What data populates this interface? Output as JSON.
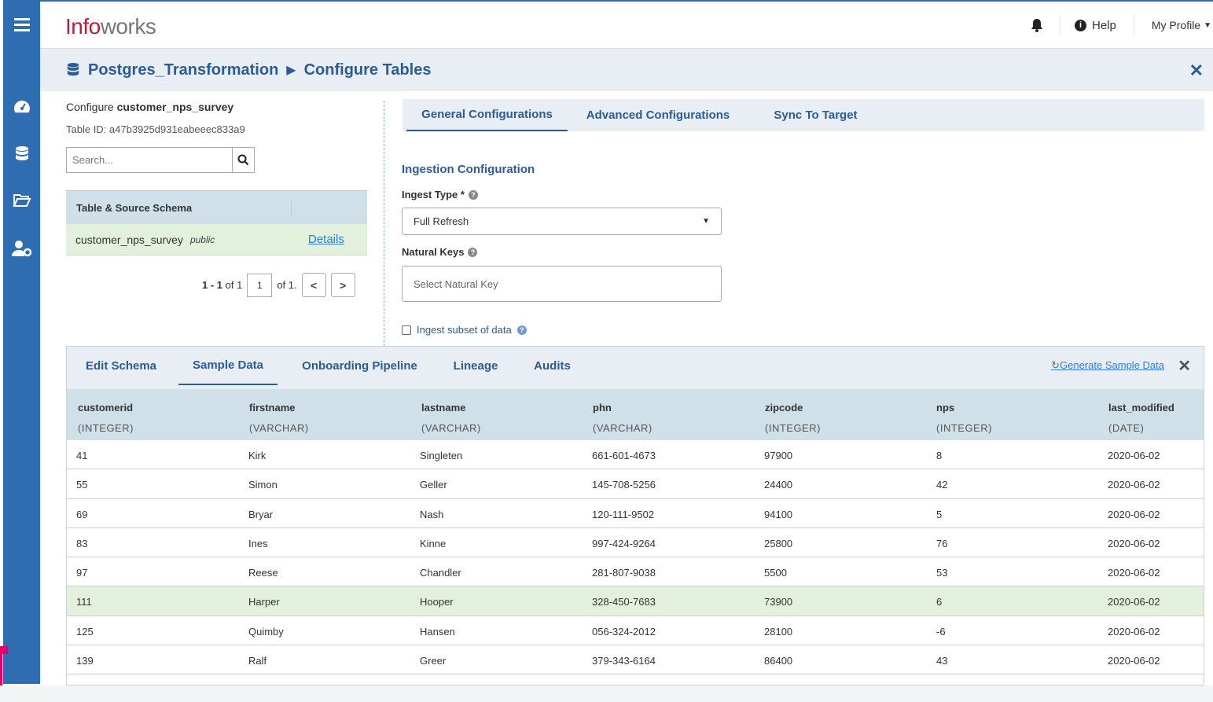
{
  "app": {
    "logo_a": "Info",
    "logo_b": "works"
  },
  "topbar": {
    "help": "Help",
    "profile": "My Profile"
  },
  "breadcrumb": {
    "source": "Postgres_Transformation",
    "page": "Configure Tables"
  },
  "left": {
    "configure_prefix": "Configure",
    "table_name": "customer_nps_survey",
    "table_id": "Table ID: a47b3925d931eabeeec833a9",
    "search_placeholder": "Search...",
    "table_header": "Table & Source Schema",
    "row": {
      "name": "customer_nps_survey",
      "schema": "public",
      "details": "Details"
    },
    "pager": {
      "range": "1 - 1",
      "of_total": "of 1",
      "page": "1",
      "of_pages": "of 1."
    }
  },
  "config_tabs": [
    "General Configurations",
    "Advanced Configurations",
    "Sync To Target"
  ],
  "ingestion": {
    "section": "Ingestion Configuration",
    "ingest_type_label": "Ingest Type *",
    "ingest_type_value": "Full Refresh",
    "natural_keys_label": "Natural Keys",
    "natural_keys_placeholder": "Select Natural Key",
    "subset_label": "Ingest subset of data"
  },
  "bottom_tabs": [
    "Edit Schema",
    "Sample Data",
    "Onboarding Pipeline",
    "Lineage",
    "Audits"
  ],
  "generate_sample": "Generate Sample Data",
  "columns": [
    {
      "name": "customerid",
      "type": "(INTEGER)"
    },
    {
      "name": "firstname",
      "type": "(VARCHAR)"
    },
    {
      "name": "lastname",
      "type": "(VARCHAR)"
    },
    {
      "name": "phn",
      "type": "(VARCHAR)"
    },
    {
      "name": "zipcode",
      "type": "(INTEGER)"
    },
    {
      "name": "nps",
      "type": "(INTEGER)"
    },
    {
      "name": "last_modified",
      "type": "(DATE)"
    }
  ],
  "rows": [
    [
      "41",
      "Kirk",
      "Singleten",
      "661-601-4673",
      "97900",
      "8",
      "2020-06-02"
    ],
    [
      "55",
      "Simon",
      "Geller",
      "145-708-5256",
      "24400",
      "42",
      "2020-06-02"
    ],
    [
      "69",
      "Bryar",
      "Nash",
      "120-111-9502",
      "94100",
      "5",
      "2020-06-02"
    ],
    [
      "83",
      "Ines",
      "Kinne",
      "997-424-9264",
      "25800",
      "76",
      "2020-06-02"
    ],
    [
      "97",
      "Reese",
      "Chandler",
      "281-807-9038",
      "5500",
      "53",
      "2020-06-02"
    ],
    [
      "111",
      "Harper",
      "Hooper",
      "328-450-7683",
      "73900",
      "6",
      "2020-06-02"
    ],
    [
      "125",
      "Quimby",
      "Hansen",
      "056-324-2012",
      "28100",
      "-6",
      "2020-06-02"
    ],
    [
      "139",
      "Ralf",
      "Greer",
      "379-343-6164",
      "86400",
      "43",
      "2020-06-02"
    ]
  ]
}
